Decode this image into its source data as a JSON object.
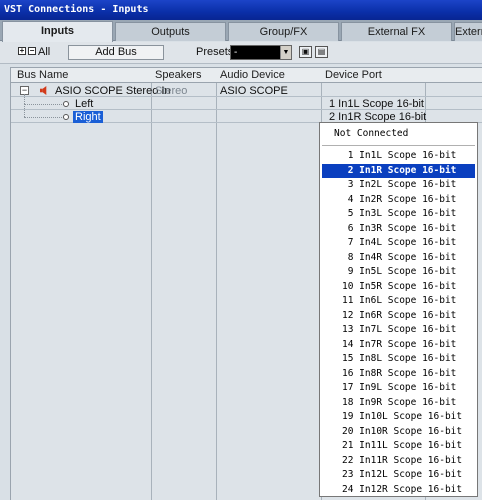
{
  "window": {
    "title": "VST Connections - Inputs"
  },
  "tabs": [
    {
      "label": "Inputs",
      "active": true
    },
    {
      "label": "Outputs",
      "active": false
    },
    {
      "label": "Group/FX",
      "active": false
    },
    {
      "label": "External FX",
      "active": false
    },
    {
      "label": "Externa",
      "active": false
    }
  ],
  "toolbar": {
    "all_label": "All",
    "add_bus_label": "Add Bus",
    "presets_label": "Presets",
    "presets_value": "-"
  },
  "columns": [
    "Bus Name",
    "Speakers",
    "Audio Device",
    "Device Port"
  ],
  "rows": [
    {
      "name": "ASIO SCOPE Stereo In",
      "speakers": "Stereo",
      "device": "ASIO SCOPE",
      "port": ""
    },
    {
      "name": "Left",
      "speakers": "",
      "device": "",
      "port": "1 In1L Scope 16-bit"
    },
    {
      "name": "Right",
      "speakers": "",
      "device": "",
      "port": "2 In1R Scope 16-bit"
    }
  ],
  "dropdown": {
    "not_connected": "Not Connected",
    "items": [
      " 1 In1L Scope 16-bit",
      " 2 In1R Scope 16-bit",
      " 3 In2L Scope 16-bit",
      " 4 In2R Scope 16-bit",
      " 5 In3L Scope 16-bit",
      " 6 In3R Scope 16-bit",
      " 7 In4L Scope 16-bit",
      " 8 In4R Scope 16-bit",
      " 9 In5L Scope 16-bit",
      "10 In5R Scope 16-bit",
      "11 In6L Scope 16-bit",
      "12 In6R Scope 16-bit",
      "13 In7L Scope 16-bit",
      "14 In7R Scope 16-bit",
      "15 In8L Scope 16-bit",
      "16 In8R Scope 16-bit",
      "17 In9L Scope 16-bit",
      "18 In9R Scope 16-bit",
      "19 In10L Scope 16-bit",
      "20 In10R Scope 16-bit",
      "21 In11L Scope 16-bit",
      "22 In11R Scope 16-bit",
      "23 In12L Scope 16-bit",
      "24 In12R Scope 16-bit"
    ],
    "selected_index": 1
  },
  "icons": {
    "expand_all": "expand-all-icon",
    "collapse_all": "collapse-all-icon",
    "speaker": "speaker-icon",
    "save_preset": "save-preset-icon",
    "delete_preset": "delete-preset-icon"
  },
  "colors": {
    "titlebar": "#0a2fa8",
    "selection": "#0a3fbf",
    "row_selection": "#1a5fd6",
    "speaker_icon": "#d23a1a"
  }
}
